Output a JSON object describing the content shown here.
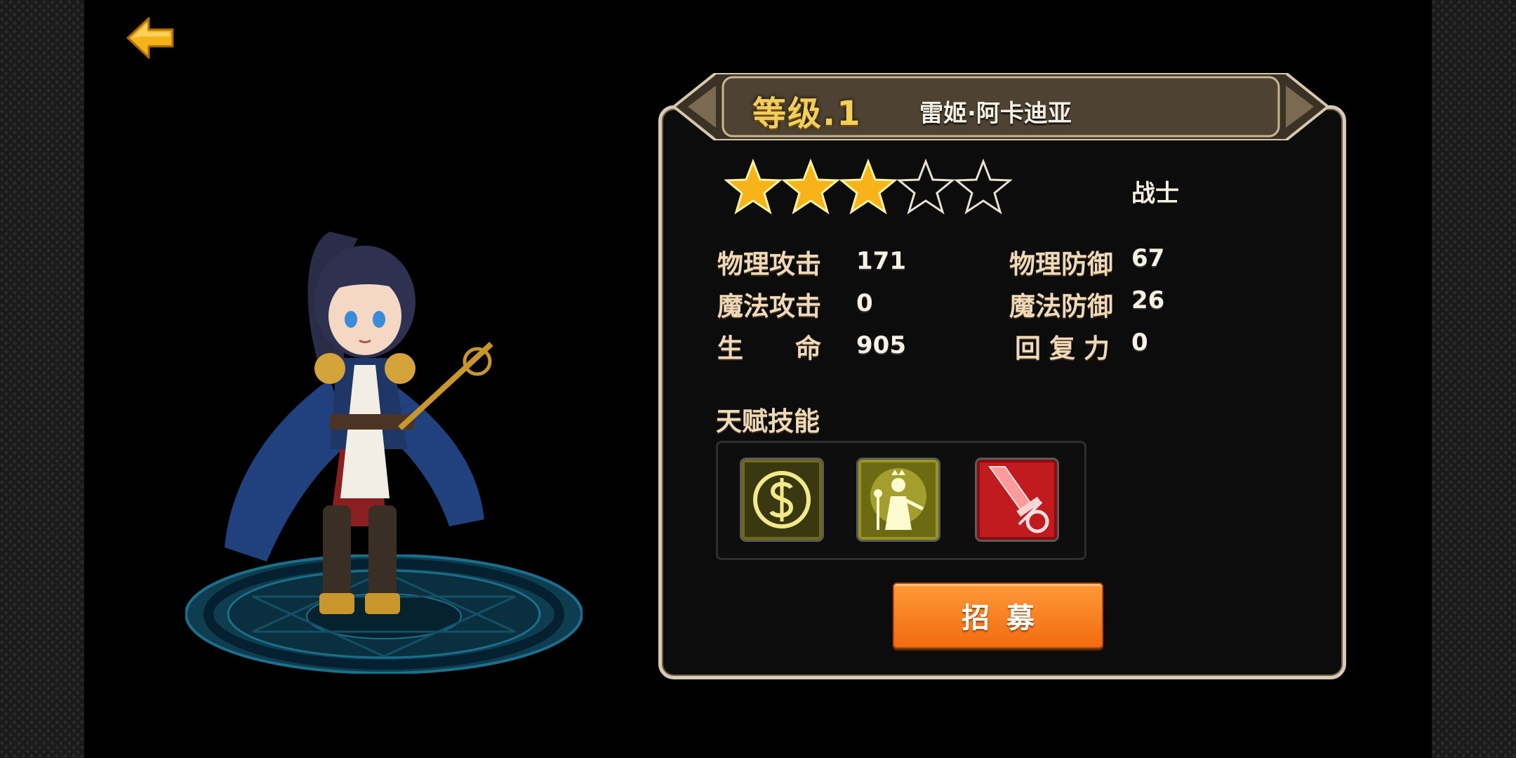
{
  "header": {
    "level_label": "等级.1",
    "hero_name": "雷姬·阿卡迪亚"
  },
  "rating": {
    "stars_filled": 3,
    "stars_total": 5
  },
  "hero_class": "战士",
  "stats": {
    "physical_attack": {
      "label": "物理攻击",
      "value": "171"
    },
    "magic_attack": {
      "label": "魔法攻击",
      "value": "0"
    },
    "hp": {
      "label": "生　　命",
      "value": "905"
    },
    "physical_defense": {
      "label": "物理防御",
      "value": "67"
    },
    "magic_defense": {
      "label": "魔法防御",
      "value": "26"
    },
    "recovery": {
      "label": "回复力",
      "value": "0"
    }
  },
  "talent": {
    "title": "天赋技能",
    "skills": [
      {
        "icon": "dollar-coin-icon"
      },
      {
        "icon": "crowned-figure-icon"
      },
      {
        "icon": "red-sword-icon"
      }
    ]
  },
  "actions": {
    "recruit_label": "招募"
  },
  "colors": {
    "accent_gold": "#f3cf5a",
    "button_orange": "#f26b0f",
    "panel_border": "#d8cbb6",
    "magic_circle": "#1b6f8c"
  }
}
